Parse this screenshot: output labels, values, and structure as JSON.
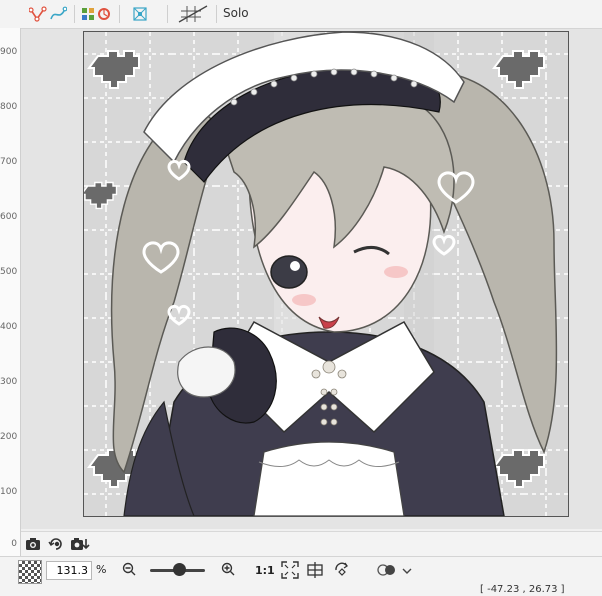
{
  "toolbar": {
    "icons": [
      "vector-path-icon",
      "curve-icon",
      "layer-grid-icon",
      "color-wheel-icon",
      "transform-icon",
      "grid-off-icon"
    ],
    "solo_label": "Solo"
  },
  "ruler": {
    "ticks": [
      "900",
      "800",
      "700",
      "600",
      "500",
      "400",
      "300",
      "200",
      "100",
      "0"
    ]
  },
  "bottom_icons": [
    "camera-icon",
    "rotate-camera-icon",
    "camera-download-icon"
  ],
  "status": {
    "zoom_value": "131.3",
    "zoom_unit": "%",
    "ratio_label": "1:1",
    "coords": "[ -47.23 , 26.73 ]"
  },
  "colors": {
    "accent_red": "#e0523f",
    "accent_teal": "#3aa6c7",
    "accent_green": "#5aa03a"
  }
}
